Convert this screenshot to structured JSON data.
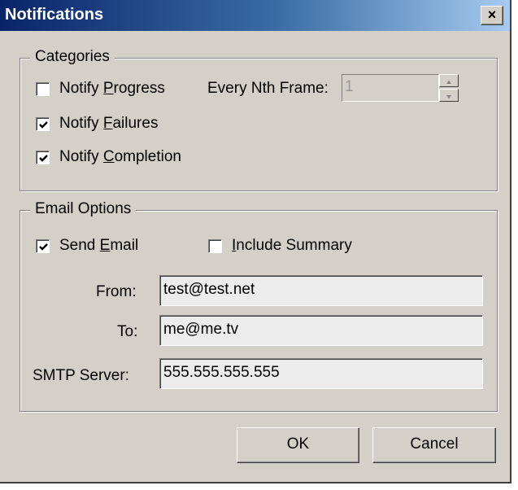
{
  "window": {
    "title": "Notifications",
    "close_glyph": "×"
  },
  "categories": {
    "legend": "Categories",
    "notify_progress": {
      "pre": "Notify ",
      "accel": "P",
      "post": "rogress",
      "checked": false
    },
    "notify_failures": {
      "pre": "Notify ",
      "accel": "F",
      "post": "ailures",
      "checked": true
    },
    "notify_completion": {
      "pre": "Notify ",
      "accel": "C",
      "post": "ompletion",
      "checked": true
    },
    "every_nth_label": "Every Nth Frame:",
    "every_nth_value": "1"
  },
  "email": {
    "legend": "Email Options",
    "send_email": {
      "pre": "Send ",
      "accel": "E",
      "post": "mail",
      "checked": true
    },
    "include_summary": {
      "pre": "",
      "accel": "I",
      "post": "nclude Summary",
      "checked": false
    },
    "from_label": "From:",
    "from_value": "test@test.net",
    "to_label": "To:",
    "to_value": "me@me.tv",
    "smtp_label": "SMTP Server:",
    "smtp_value": "555.555.555.555"
  },
  "buttons": {
    "ok": "OK",
    "cancel": "Cancel"
  },
  "icons": {
    "check": "check-mark-icon",
    "close": "close-icon",
    "spin_up": "arrow-up-icon",
    "spin_down": "arrow-down-icon"
  }
}
